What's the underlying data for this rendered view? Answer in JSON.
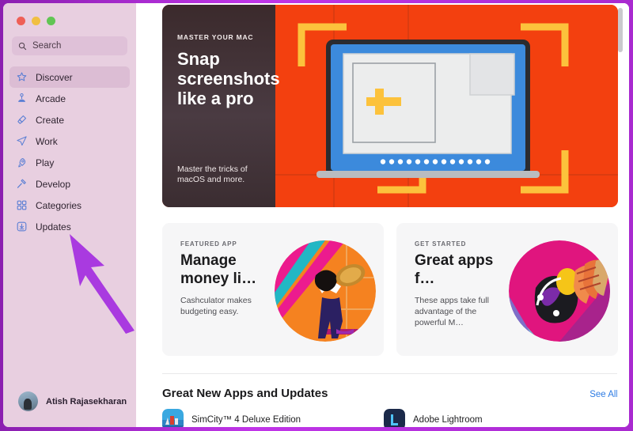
{
  "window": {
    "traffic_lights": [
      {
        "name": "close",
        "color": "#ef5f56"
      },
      {
        "name": "minimize",
        "color": "#f1bf42"
      },
      {
        "name": "zoom",
        "color": "#61c554"
      }
    ]
  },
  "sidebar": {
    "search": {
      "placeholder": "Search",
      "value": "",
      "icon": "search-icon"
    },
    "items": [
      {
        "label": "Discover",
        "icon": "star-icon",
        "selected": true
      },
      {
        "label": "Arcade",
        "icon": "joystick-icon",
        "selected": false
      },
      {
        "label": "Create",
        "icon": "paintbrush-icon",
        "selected": false
      },
      {
        "label": "Work",
        "icon": "paper-plane-icon",
        "selected": false
      },
      {
        "label": "Play",
        "icon": "rocket-icon",
        "selected": false
      },
      {
        "label": "Develop",
        "icon": "hammer-icon",
        "selected": false
      },
      {
        "label": "Categories",
        "icon": "grid-icon",
        "selected": false
      },
      {
        "label": "Updates",
        "icon": "download-icon",
        "selected": false
      }
    ],
    "user": {
      "name": "Atish Rajasekharan",
      "avatar": "user-avatar"
    },
    "background_color": "#e8cfe0",
    "selected_color": "#dcbdd4",
    "icon_color": "#5b7fd4"
  },
  "annotation": {
    "arrow_color": "#a93ae0",
    "points_to": "Updates"
  },
  "hero": {
    "eyebrow": "MASTER YOUR MAC",
    "title": "Snap screenshots like a pro",
    "subtitle": "Master the tricks of macOS and more.",
    "background_color": "#f3400f",
    "accent_color": "#fcc23c"
  },
  "cards": [
    {
      "eyebrow": "FEATURED APP",
      "title": "Manage money li…",
      "description": "Cashculator makes budgeting easy.",
      "art": "money-illustration"
    },
    {
      "eyebrow": "GET STARTED",
      "title": "Great apps f…",
      "description": "These apps take full advantage of the powerful M…",
      "art": "apps-illustration"
    }
  ],
  "section": {
    "title": "Great New Apps and Updates",
    "see_all": "See All",
    "apps": [
      {
        "name": "SimCity™ 4 Deluxe Edition",
        "icon": "simcity-icon"
      },
      {
        "name": "Adobe Lightroom",
        "icon": "lightroom-icon"
      }
    ]
  },
  "scrollbar": {
    "name": "vertical-scrollbar"
  }
}
